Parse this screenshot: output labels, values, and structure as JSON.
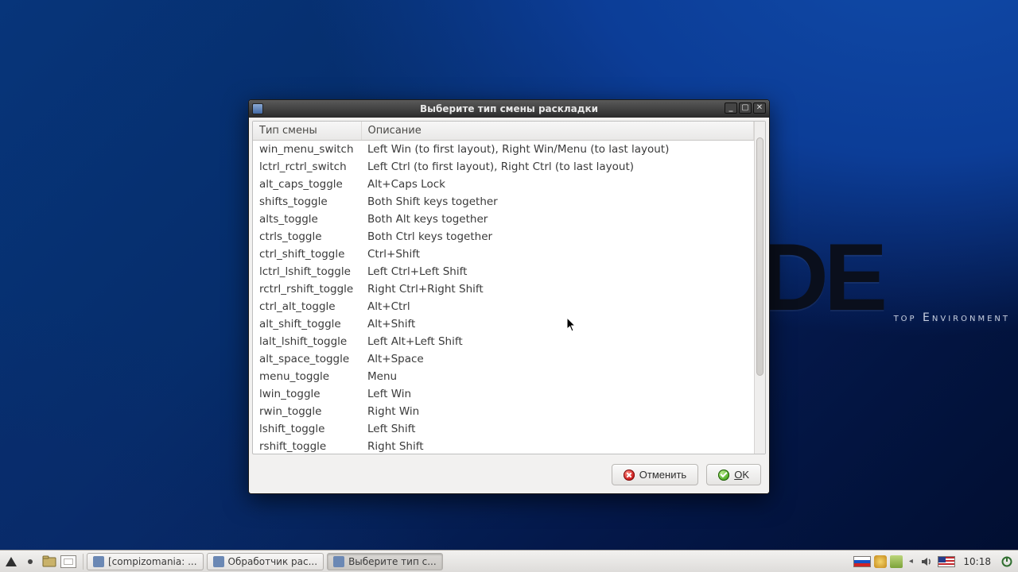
{
  "desktop": {
    "brand_letters": "DE",
    "brand_tagline": "top Environment"
  },
  "dialog": {
    "title": "Выберите тип смены раскладки",
    "columns": {
      "type": "Тип смены",
      "desc": "Описание"
    },
    "rows": [
      {
        "type": "win_menu_switch",
        "desc": "Left Win (to first layout), Right Win/Menu (to last layout)"
      },
      {
        "type": "lctrl_rctrl_switch",
        "desc": "Left Ctrl (to first layout), Right Ctrl (to last layout)"
      },
      {
        "type": "alt_caps_toggle",
        "desc": "Alt+Caps Lock"
      },
      {
        "type": "shifts_toggle",
        "desc": "Both Shift keys together"
      },
      {
        "type": "alts_toggle",
        "desc": "Both Alt keys together"
      },
      {
        "type": "ctrls_toggle",
        "desc": "Both Ctrl keys together"
      },
      {
        "type": "ctrl_shift_toggle",
        "desc": "Ctrl+Shift"
      },
      {
        "type": "lctrl_lshift_toggle",
        "desc": "Left Ctrl+Left Shift"
      },
      {
        "type": "rctrl_rshift_toggle",
        "desc": "Right Ctrl+Right Shift"
      },
      {
        "type": "ctrl_alt_toggle",
        "desc": "Alt+Ctrl"
      },
      {
        "type": "alt_shift_toggle",
        "desc": "Alt+Shift"
      },
      {
        "type": "lalt_lshift_toggle",
        "desc": "Left Alt+Left Shift"
      },
      {
        "type": "alt_space_toggle",
        "desc": "Alt+Space"
      },
      {
        "type": "menu_toggle",
        "desc": "Menu"
      },
      {
        "type": "lwin_toggle",
        "desc": "Left Win"
      },
      {
        "type": "rwin_toggle",
        "desc": "Right Win"
      },
      {
        "type": "lshift_toggle",
        "desc": "Left Shift"
      },
      {
        "type": "rshift_toggle",
        "desc": "Right Shift"
      }
    ],
    "buttons": {
      "cancel_label": "Отменить",
      "ok_label_pre": "",
      "ok_label_underline": "O",
      "ok_label_post": "K"
    }
  },
  "panel": {
    "tasks": [
      {
        "label": "[compizomania: ...",
        "active": false
      },
      {
        "label": "Обработчик рас...",
        "active": false
      },
      {
        "label": "Выберите тип с...",
        "active": true
      }
    ],
    "clock": "10:18"
  }
}
